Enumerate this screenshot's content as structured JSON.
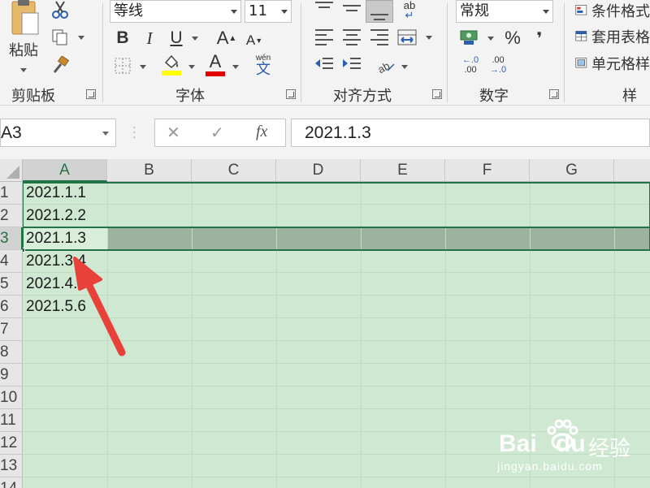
{
  "ribbon": {
    "clipboard": {
      "paste_label": "粘贴",
      "group_label": "剪贴板"
    },
    "font": {
      "font_name": "等线",
      "font_size": "11",
      "bold": "B",
      "italic": "I",
      "underline": "U",
      "grow": "A",
      "shrink": "A",
      "phonetic_top": "wén",
      "phonetic_char": "文",
      "group_label": "字体",
      "highlight_color": "#ffff00",
      "font_color": "#e00000"
    },
    "alignment": {
      "wrap_glyph": "ab",
      "group_label": "对齐方式"
    },
    "number": {
      "format": "常规",
      "percent": "%",
      "comma": "❜",
      "inc_dec_top": "←.0",
      "inc_dec_bottom": ".00",
      "dec_dec_top": ".00",
      "dec_dec_bottom": "→.0",
      "group_label": "数字"
    },
    "styles": {
      "conditional": "条件格式",
      "table": "套用表格",
      "cell": "单元格样",
      "group_label": "样式"
    }
  },
  "formula_bar": {
    "name_box": "A3",
    "cancel": "✕",
    "enter": "✓",
    "fx": "fx",
    "value": "2021.1.3"
  },
  "grid": {
    "columns": [
      "A",
      "B",
      "C",
      "D",
      "E",
      "F",
      "G"
    ],
    "rows": [
      "1",
      "2",
      "3",
      "4",
      "5",
      "6",
      "7",
      "8",
      "9",
      "10",
      "11",
      "12",
      "13",
      "14"
    ],
    "cells_a": [
      "2021.1.1",
      "2021.2.2",
      "2021.1.3",
      "2021.3.4",
      "2021.4.",
      "2021.5.6"
    ],
    "active_cell": "A3"
  },
  "watermark": {
    "brand": "Bai",
    "brand2": "du",
    "cn": "经验",
    "url": "jingyan.baidu.com"
  },
  "colors": {
    "accent": "#217346",
    "selection_fill": "#cfe8d1",
    "arrow": "#e8413a"
  }
}
